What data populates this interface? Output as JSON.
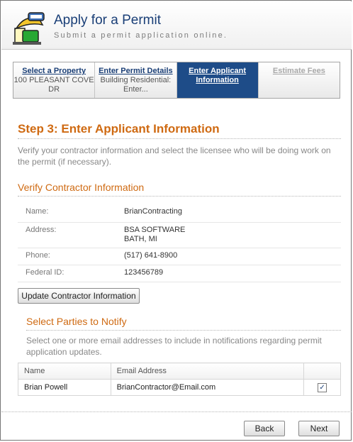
{
  "header": {
    "title": "Apply for a Permit",
    "subtitle": "Submit a permit application online.",
    "logo_icon": "hardhat-icon"
  },
  "wizard": {
    "steps": [
      {
        "title": "Select a Property",
        "sub": "100 PLEASANT COVE DR",
        "state": "done"
      },
      {
        "title": "Enter Permit Details",
        "sub": "Building Residential: Enter...",
        "state": "done"
      },
      {
        "title": "Enter Applicant Information",
        "sub": "",
        "state": "current"
      },
      {
        "title": "Estimate Fees",
        "sub": "",
        "state": "disabled"
      }
    ]
  },
  "step": {
    "title": "Step 3: Enter Applicant Information",
    "description": "Verify your contractor information and select the licensee who will be doing work on the permit (if necessary)."
  },
  "contractor": {
    "title": "Verify Contractor Information",
    "fields": [
      {
        "label": "Name:",
        "value": "BrianContracting"
      },
      {
        "label": "Address:",
        "value": "BSA SOFTWARE",
        "value2": "BATH, MI"
      },
      {
        "label": "Phone:",
        "value": "(517) 641-8900"
      },
      {
        "label": "Federal ID:",
        "value": "123456789"
      }
    ],
    "update_button": "Update Contractor Information"
  },
  "notify": {
    "title": "Select Parties to Notify",
    "description": "Select one or more email addresses to include in notifications regarding permit application updates.",
    "columns": [
      "Name",
      "Email Address",
      ""
    ],
    "rows": [
      {
        "name": "Brian Powell",
        "email": "BrianContractor@Email.com",
        "checked": true
      }
    ]
  },
  "footer": {
    "back": "Back",
    "next": "Next"
  },
  "colors": {
    "accent": "#cf6a12",
    "brand": "#1a3f77",
    "current_step_bg": "#1e4c88"
  }
}
